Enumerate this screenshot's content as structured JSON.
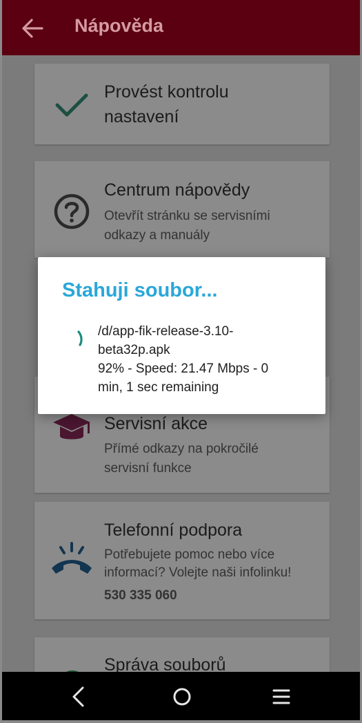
{
  "appbar": {
    "title": "Nápověda",
    "back_icon": "arrow-left-icon"
  },
  "cards": [
    {
      "id": "check",
      "title_line1": "Provést kontrolu",
      "title_line2": "nastavení",
      "icon": "checkmark-icon",
      "icon_color": "#1c6b55"
    },
    {
      "id": "help",
      "title": "Centrum nápovědy",
      "sub_line1": "Otevřít stránku se servisními",
      "sub_line2": "odkazy a manuály",
      "icon": "question-circle-icon"
    },
    {
      "id": "service",
      "title": "Servisní akce",
      "sub_line1": "Přímé odkazy na pokročilé",
      "sub_line2": "servisní funkce",
      "icon": "graduation-cap-icon",
      "icon_color": "#5a1a3a"
    },
    {
      "id": "phone",
      "title": "Telefonní podpora",
      "sub_line1": "Potřebujete pomoc nebo více",
      "sub_line2": "informací? Volejte naši infolinku!",
      "phone": "530 335 060",
      "icon": "phone-ringing-icon",
      "icon_color": "#153c5a"
    },
    {
      "id": "files",
      "title": "Správa souborů",
      "icon": "folder-icon"
    }
  ],
  "dialog": {
    "title": "Stahuji soubor...",
    "line1": "/d/app-fik-release-3.10-",
    "line2": "beta32p.apk",
    "line3": "92% - Speed: 21.47 Mbps - 0",
    "line4": "min, 1 sec remaining",
    "progress_percent": 92,
    "accent": "#2aa7d9",
    "spinner_color": "#1a8c7c"
  },
  "navbar": {
    "back_icon": "nav-back-icon",
    "home_icon": "nav-home-icon",
    "recents_icon": "nav-menu-icon"
  }
}
